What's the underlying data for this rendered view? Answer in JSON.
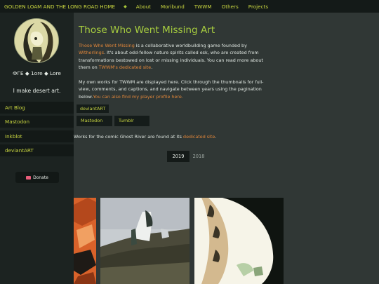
{
  "nav": {
    "site_title": "GOLDEN LOAM AND THE LONG ROAD HOME",
    "separator": "◆",
    "links": [
      "About",
      "Moribund",
      "TWWM",
      "Others",
      "Projects"
    ]
  },
  "sidebar": {
    "tagline": "ФГЕ ◆ 1ore ◆ Lore",
    "about": "I make desert art.",
    "links": [
      "Art Blog",
      "Mastodon",
      "Inkblot",
      "deviantART"
    ],
    "donate_label": "Donate"
  },
  "main": {
    "title": "Those Who Went Missing Art",
    "intro": {
      "link1": "Those Who Went Missing",
      "t1": " is a collaborative worldbuilding game founded by ",
      "link2": "Witherlings",
      "t2": ". It's about odd-fellow nature spirits called esk, who are created from transformations bestowed on lost or missing individuals. You can read more about them on ",
      "link3": "TWWM's dedicated site",
      "t3": "."
    },
    "works": {
      "t1": "My own works for TWWM are displayed here. Click through the thumbnails for full-view, comments, and captions, and navigate between years using the pagination below.",
      "link1": "You can also find my player profile here."
    },
    "tags": [
      "deviantART",
      "Mastodon",
      "Tumblr"
    ],
    "ghost": {
      "t1": "Works for the comic Ghost River are found at its ",
      "link1": "dedicated site",
      "t2": "."
    },
    "pagination": {
      "active": "2019",
      "other": "2018"
    }
  }
}
